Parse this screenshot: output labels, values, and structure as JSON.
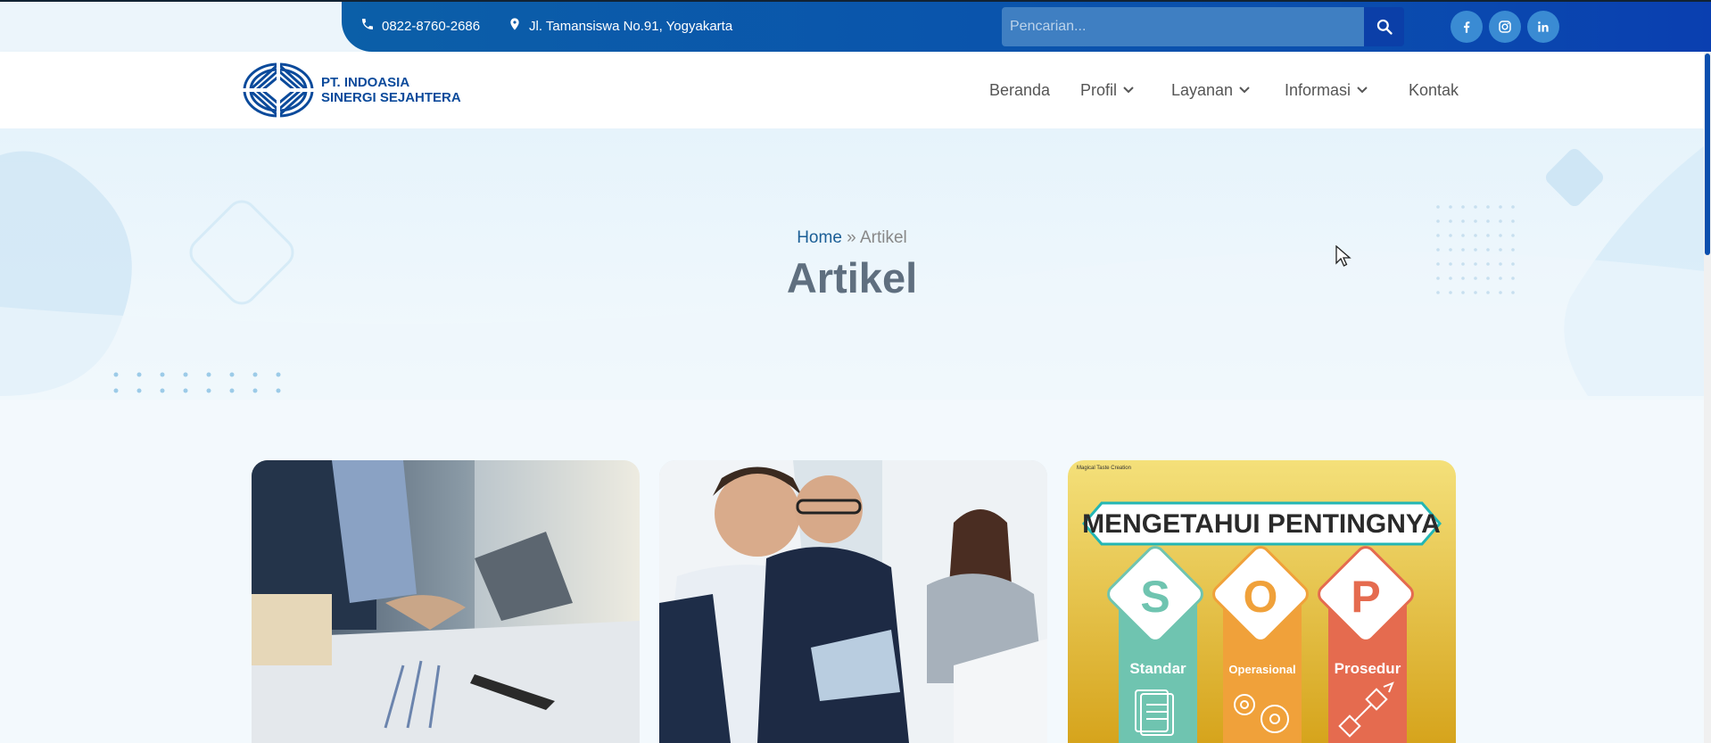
{
  "topbar": {
    "phone": "0822-8760-2686",
    "address": "Jl. Tamansiswa No.91, Yogyakarta",
    "search_placeholder": "Pencarian...",
    "socials": [
      "facebook-icon",
      "instagram-icon",
      "linkedin-icon"
    ]
  },
  "logo": {
    "line1": "PT. INDOASIA",
    "line2": "SINERGI SEJAHTERA"
  },
  "nav": {
    "items": [
      {
        "label": "Beranda",
        "dropdown": false
      },
      {
        "label": "Profil",
        "dropdown": true
      },
      {
        "label": "Layanan",
        "dropdown": true
      },
      {
        "label": "Informasi",
        "dropdown": true
      },
      {
        "label": "Kontak",
        "dropdown": false
      }
    ]
  },
  "hero": {
    "breadcrumb_home": "Home",
    "breadcrumb_sep": "»",
    "breadcrumb_current": "Artikel",
    "title": "Artikel"
  },
  "cards": [
    {
      "image": "office meeting with laptop and charts"
    },
    {
      "image": "business people discussing with tablet"
    },
    {
      "image": "SOP infographic",
      "credit": "Magical Taste Creation",
      "banner": "MENGETAHUI PENTINGNYA",
      "letters": [
        "S",
        "O",
        "P"
      ],
      "words": [
        "Standar",
        "Operasional",
        "Prosedur"
      ]
    }
  ],
  "colors": {
    "primary": "#0b4fae",
    "accent": "#3a8bd3",
    "title": "#5f6f7f"
  }
}
